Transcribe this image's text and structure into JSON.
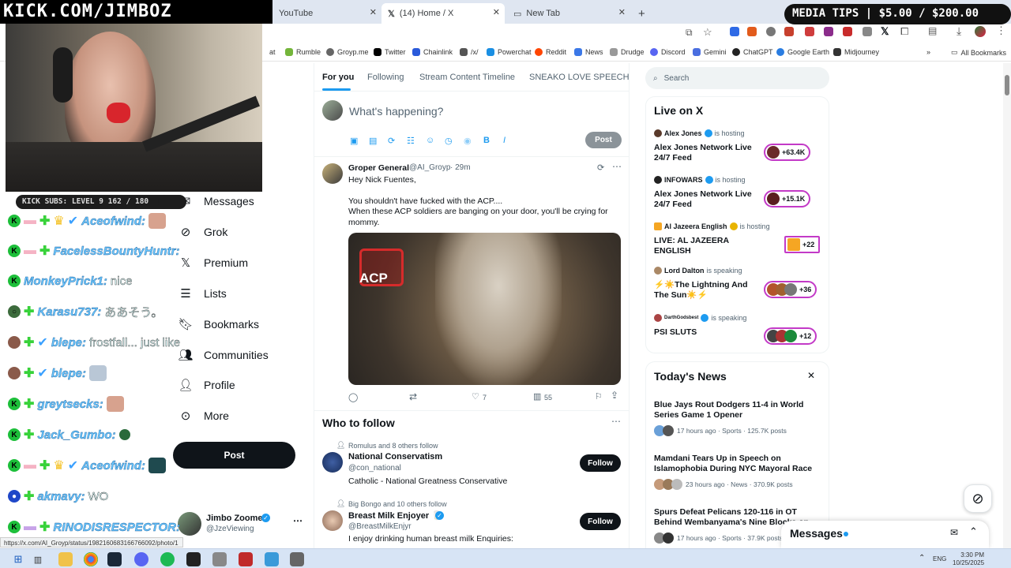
{
  "overlay": {
    "banner": "KICK.COM/JIMBOZ",
    "media_tips": "MEDIA TIPS | $5.00 / $200.00",
    "subs": "KICK SUBS: LEVEL 9 162 / 180"
  },
  "browser": {
    "tabs": [
      {
        "label": "YouTube"
      },
      {
        "label": "(14) Home / X"
      },
      {
        "label": "New Tab"
      }
    ],
    "bookmarks": [
      "Rumble",
      "Groyp.me",
      "Twitter",
      "Chainlink",
      "/x/",
      "Powerchat",
      "Reddit",
      "News",
      "Drudge",
      "Discord",
      "Gemini",
      "ChatGPT",
      "Google Earth",
      "Midjourney"
    ],
    "all_bookmarks": "All Bookmarks",
    "status_url": "https://x.com/AI_Groyp/status/1982160683166766092/photo/1"
  },
  "chat": [
    {
      "user": "Aceofwind:",
      "msg": ""
    },
    {
      "user": "FacelessBountyHuntr:",
      "msg": ""
    },
    {
      "user": "MonkeyPrick1:",
      "msg": "nice"
    },
    {
      "user": "Karasu737:",
      "msg": "ああそう。"
    },
    {
      "user": "blepe:",
      "msg": "frostfall... just like skyrim..."
    },
    {
      "user": "blepe:",
      "msg": ""
    },
    {
      "user": "greytsecks:",
      "msg": ""
    },
    {
      "user": "Jack_Gumbo:",
      "msg": ""
    },
    {
      "user": "Aceofwind:",
      "msg": ""
    },
    {
      "user": "akmavy:",
      "msg": "WO"
    },
    {
      "user": "RINODISRESPECTOR:",
      "msg": ""
    }
  ],
  "nav": {
    "items": [
      "Messages",
      "Grok",
      "Premium",
      "Lists",
      "Bookmarks",
      "Communities",
      "Profile",
      "More"
    ],
    "post_label": "Post",
    "profile_name": "Jimbo Zoomer",
    "profile_handle": "@JzeViewing"
  },
  "feed": {
    "tabs": [
      "For you",
      "Following",
      "Stream Content Timeline",
      "SNEAKO LOVE SPEECH"
    ],
    "compose_placeholder": "What's happening?",
    "compose_post": "Post",
    "tweet": {
      "name": "Groper General",
      "handle": "@AI_Groyp",
      "time": "· 29m",
      "line1": "Hey Nick Fuentes,",
      "line2": "You shouldn't have fucked with the ACP....",
      "line3": "When these ACP soldiers are banging on your door, you'll be crying for mommy.",
      "image_text": "ACP",
      "likes": "7",
      "views": "55"
    },
    "who_to_follow": "Who to follow",
    "suggestions": [
      {
        "social": "Romulus and 8 others follow",
        "name": "National Conservatism",
        "handle": "@con_national",
        "bio": "Catholic - National Greatness Conservative",
        "btn": "Follow"
      },
      {
        "social": "Big Bongo and 10 others follow",
        "name": "Breast Milk Enjoyer 🥛",
        "handle": "@BreastMilkEnjyr",
        "bio": "I enjoy drinking human breast milk Enquiries:",
        "btn": "Follow"
      }
    ]
  },
  "sidebar": {
    "search_placeholder": "Search",
    "live_title": "Live on X",
    "live": [
      {
        "host": "Alex Jones",
        "status": "is hosting",
        "title": "Alex Jones Network Live 24/7 Feed",
        "count": "+63.4K"
      },
      {
        "host": "INFOWARS",
        "status": "is hosting",
        "title": "Alex Jones Network Live 24/7 Feed",
        "count": "+15.1K"
      },
      {
        "host": "Al Jazeera English",
        "status": "is hosting",
        "title": "LIVE: AL JAZEERA ENGLISH",
        "count": "+22"
      },
      {
        "host": "Lord Dalton",
        "status": "is speaking",
        "title": "⚡☀️The Lightning And The Sun☀️⚡",
        "count": "+36"
      },
      {
        "host": "DarthGodsbest",
        "status": "is speaking",
        "title": "PSI SLUTS",
        "count": "+12"
      }
    ],
    "news_title": "Today's News",
    "news": [
      {
        "title": "Blue Jays Rout Dodgers 11-4 in World Series Game 1 Opener",
        "meta": "17 hours ago · Sports · 125.7K posts"
      },
      {
        "title": "Mamdani Tears Up in Speech on Islamophobia During NYC Mayoral Race",
        "meta": "23 hours ago · News · 370.9K posts"
      },
      {
        "title": "Spurs Defeat Pelicans 120-116 in OT Behind Wembanyama's Nine Blocks on Wi...",
        "meta": "17 hours ago · Sports · 37.9K posts"
      }
    ],
    "messages_label": "Messages"
  },
  "taskbar": {
    "time": "3:30 PM",
    "date": "10/25/2025",
    "lang": "ENG"
  }
}
